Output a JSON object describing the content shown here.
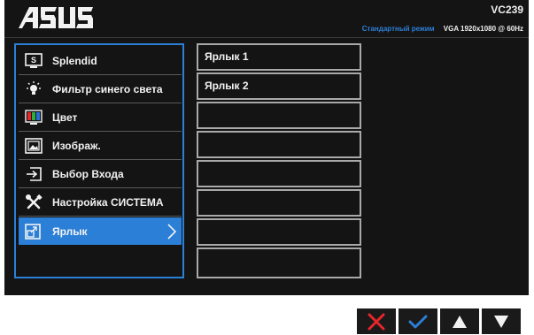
{
  "brand": "ASUS",
  "header": {
    "model": "VC239",
    "mode": "Стандартный режим",
    "signal": "VGA  1920x1080 @ 60Hz"
  },
  "menu": {
    "items": [
      {
        "label": "Splendid",
        "icon": "splendid-s-icon"
      },
      {
        "label": "Фильтр синего света",
        "icon": "bulb-icon"
      },
      {
        "label": "Цвет",
        "icon": "color-bars-icon"
      },
      {
        "label": "Изображ.",
        "icon": "picture-icon"
      },
      {
        "label": "Выбор Входа",
        "icon": "input-select-icon"
      },
      {
        "label": "Настройка СИСТЕМА",
        "icon": "tools-icon"
      },
      {
        "label": "Ярлык",
        "icon": "shortcut-icon",
        "selected": true
      },
      {
        "label": ""
      }
    ]
  },
  "submenu": {
    "items": [
      "Ярлык 1",
      "Ярлык 2",
      "",
      "",
      "",
      "",
      "",
      ""
    ]
  },
  "keys": [
    "close-icon",
    "check-icon",
    "up-arrow-icon",
    "down-arrow-icon"
  ],
  "colors": {
    "accent": "#2b7fd6",
    "close": "#e5262a",
    "check": "#2b7fd6",
    "background": "#141414"
  }
}
